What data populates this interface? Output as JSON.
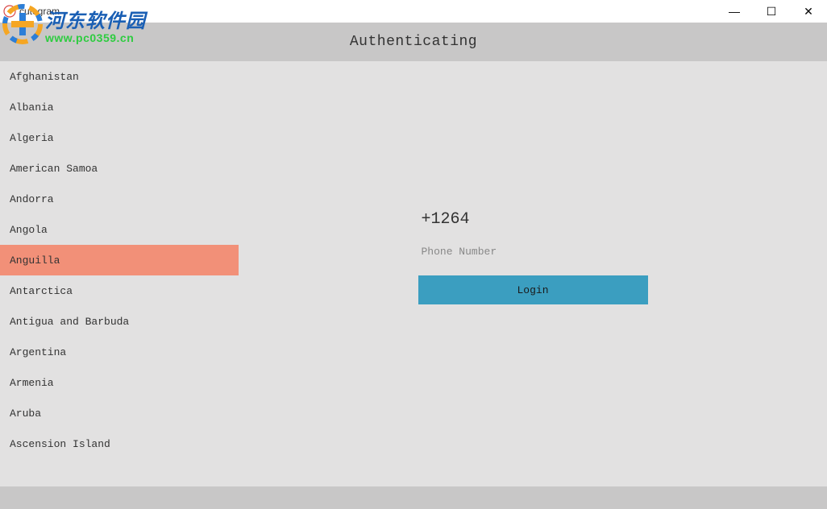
{
  "window": {
    "title": "cutegram",
    "controls": {
      "minimize": "—",
      "maximize": "☐",
      "close": "✕"
    }
  },
  "header": {
    "title": "Authenticating"
  },
  "countries": [
    {
      "name": "Afghanistan",
      "selected": false
    },
    {
      "name": "Albania",
      "selected": false
    },
    {
      "name": "Algeria",
      "selected": false
    },
    {
      "name": "American Samoa",
      "selected": false
    },
    {
      "name": "Andorra",
      "selected": false
    },
    {
      "name": "Angola",
      "selected": false
    },
    {
      "name": "Anguilla",
      "selected": true
    },
    {
      "name": "Antarctica",
      "selected": false
    },
    {
      "name": "Antigua and Barbuda",
      "selected": false
    },
    {
      "name": "Argentina",
      "selected": false
    },
    {
      "name": "Armenia",
      "selected": false
    },
    {
      "name": "Aruba",
      "selected": false
    },
    {
      "name": "Ascension Island",
      "selected": false
    }
  ],
  "form": {
    "dial_code": "+1264",
    "phone_placeholder": "Phone Number",
    "login_label": "Login"
  },
  "watermark": {
    "cn": "河东软件园",
    "url": "www.pc0359.cn"
  }
}
